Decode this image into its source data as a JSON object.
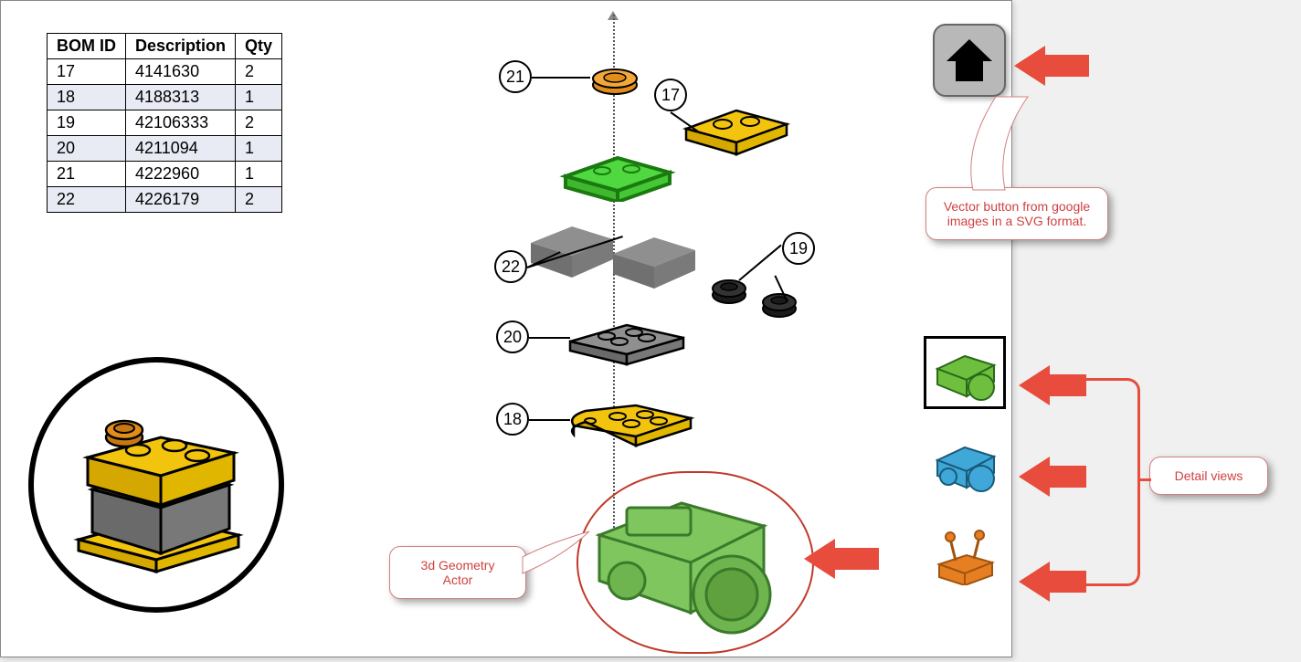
{
  "bom": {
    "headers": {
      "id": "BOM ID",
      "desc": "Description",
      "qty": "Qty"
    },
    "rows": [
      {
        "id": "17",
        "desc": "4141630",
        "qty": "2"
      },
      {
        "id": "18",
        "desc": "4188313",
        "qty": "1"
      },
      {
        "id": "19",
        "desc": "42106333",
        "qty": "2"
      },
      {
        "id": "20",
        "desc": "4211094",
        "qty": "1"
      },
      {
        "id": "21",
        "desc": "4222960",
        "qty": "1"
      },
      {
        "id": "22",
        "desc": "4226179",
        "qty": "2"
      }
    ]
  },
  "balloons": {
    "b17": "17",
    "b18": "18",
    "b19": "19",
    "b20": "20",
    "b21": "21",
    "b22": "22"
  },
  "callouts": {
    "vector_button": "Vector button from google images in a SVG format.",
    "detail_views": "Detail views",
    "geometry_actor": "3d Geometry Actor"
  },
  "icons": {
    "home": "home-icon"
  },
  "thumbnails": [
    {
      "name": "thumb-green-truck",
      "color": "#6fbf3f",
      "selected": true
    },
    {
      "name": "thumb-blue-truck",
      "color": "#3fa8d8",
      "selected": false
    },
    {
      "name": "thumb-orange-controls",
      "color": "#e67e22",
      "selected": false
    }
  ],
  "parts_colors": {
    "orange": "#e28c1a",
    "yellow": "#f2c40d",
    "green": "#4fd83f",
    "grey": "#8f8f8f",
    "darkgrey": "#707070",
    "black": "#1a1a1a"
  }
}
